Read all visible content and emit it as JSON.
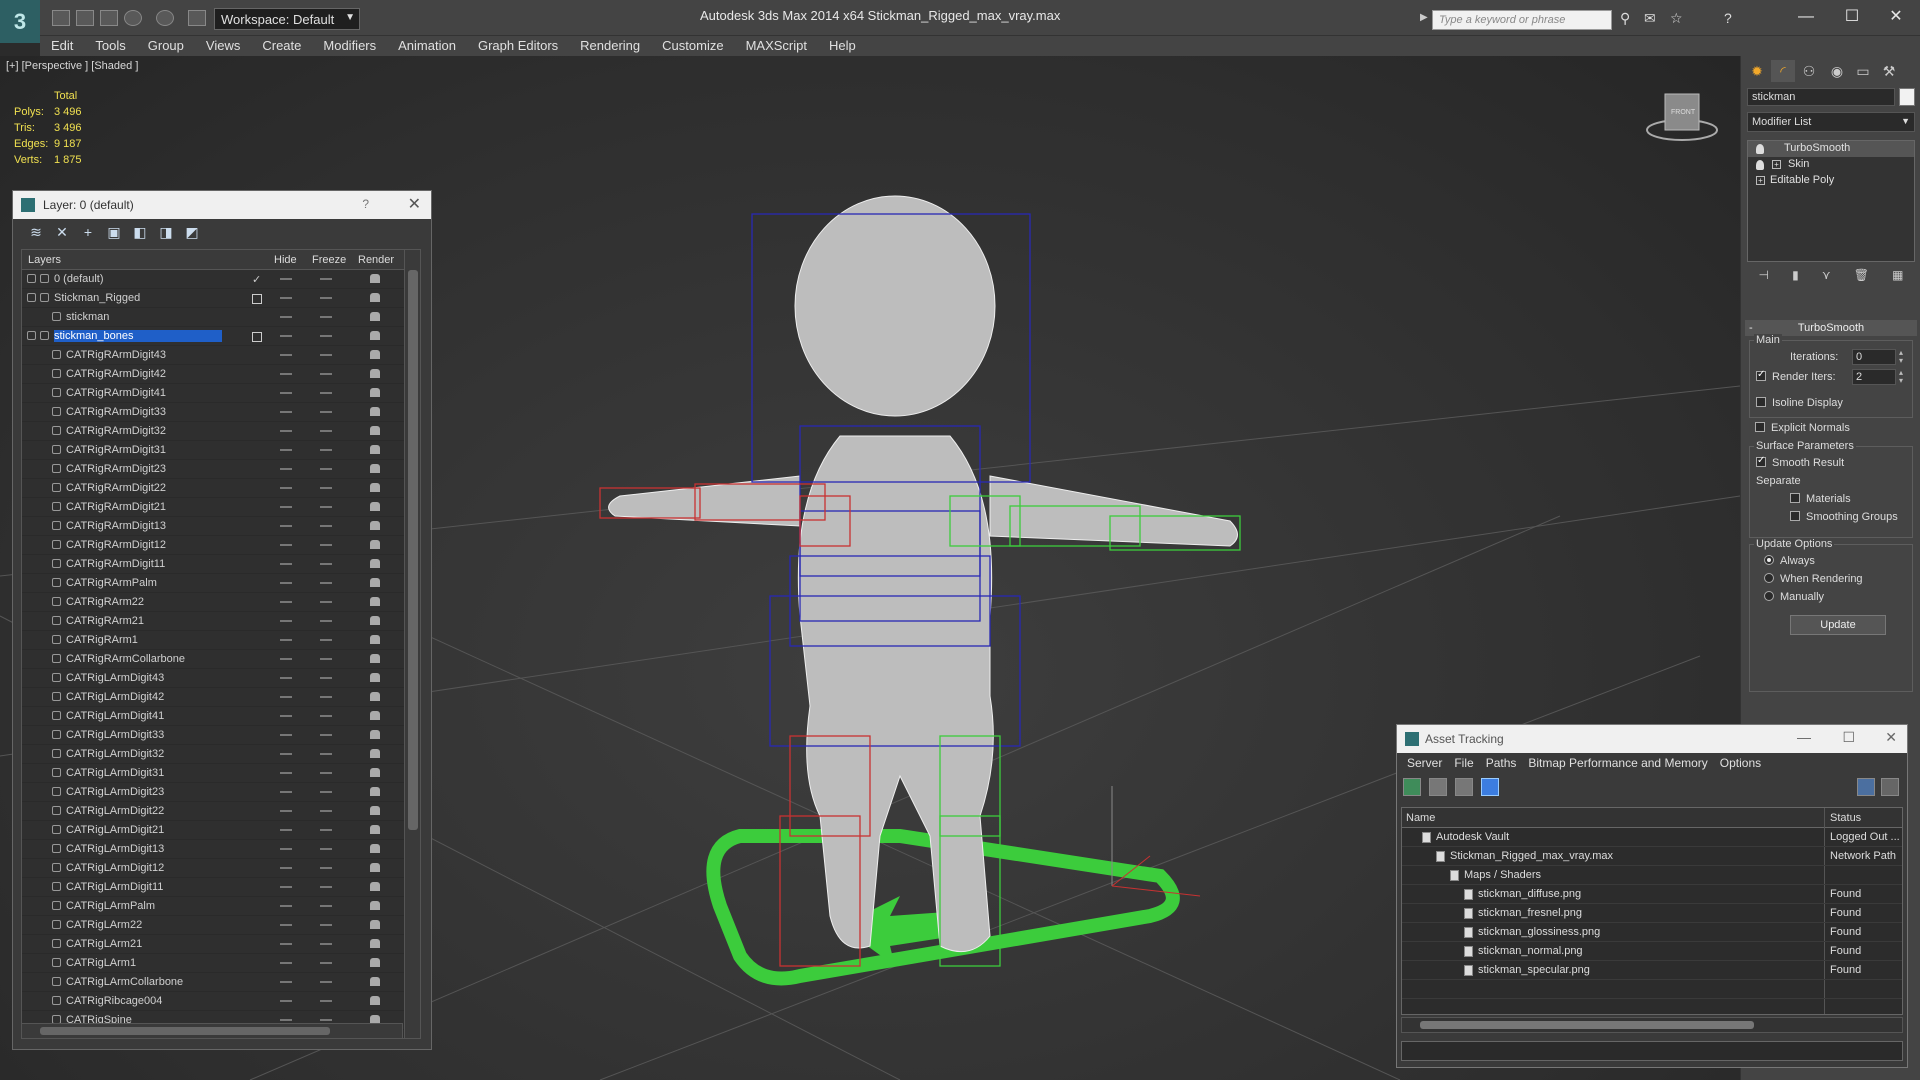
{
  "app": {
    "logo": "3",
    "title": "Autodesk 3ds Max  2014 x64     Stickman_Rigged_max_vray.max",
    "workspace": "Workspace: Default",
    "search_placeholder": "Type a keyword or phrase",
    "minimize": "—",
    "maximize": "☐",
    "close": "✕"
  },
  "menu": [
    "Edit",
    "Tools",
    "Group",
    "Views",
    "Create",
    "Modifiers",
    "Animation",
    "Graph Editors",
    "Rendering",
    "Customize",
    "MAXScript",
    "Help"
  ],
  "viewport": {
    "label": "[+] [Perspective ] [Shaded ]",
    "stats": {
      "header": "Total",
      "rows": [
        {
          "k": "Polys:",
          "v": "3 496"
        },
        {
          "k": "Tris:",
          "v": "3 496"
        },
        {
          "k": "Edges:",
          "v": "9 187"
        },
        {
          "k": "Verts:",
          "v": "1 875"
        }
      ]
    },
    "viewcube_label": "FRONT"
  },
  "layer_dialog": {
    "title": "Layer: 0 (default)",
    "help": "?",
    "close": "✕",
    "columns": {
      "layers": "Layers",
      "hide": "Hide",
      "freeze": "Freeze",
      "render": "Render"
    },
    "rows": [
      {
        "name": "0 (default)",
        "indent": 0,
        "mark": "check"
      },
      {
        "name": "Stickman_Rigged",
        "indent": 0,
        "mark": "box"
      },
      {
        "name": "stickman",
        "indent": 1
      },
      {
        "name": "stickman_bones",
        "indent": 0,
        "mark": "box",
        "selected": true
      },
      {
        "name": "CATRigRArmDigit43",
        "indent": 1
      },
      {
        "name": "CATRigRArmDigit42",
        "indent": 1
      },
      {
        "name": "CATRigRArmDigit41",
        "indent": 1
      },
      {
        "name": "CATRigRArmDigit33",
        "indent": 1
      },
      {
        "name": "CATRigRArmDigit32",
        "indent": 1
      },
      {
        "name": "CATRigRArmDigit31",
        "indent": 1
      },
      {
        "name": "CATRigRArmDigit23",
        "indent": 1
      },
      {
        "name": "CATRigRArmDigit22",
        "indent": 1
      },
      {
        "name": "CATRigRArmDigit21",
        "indent": 1
      },
      {
        "name": "CATRigRArmDigit13",
        "indent": 1
      },
      {
        "name": "CATRigRArmDigit12",
        "indent": 1
      },
      {
        "name": "CATRigRArmDigit11",
        "indent": 1
      },
      {
        "name": "CATRigRArmPalm",
        "indent": 1
      },
      {
        "name": "CATRigRArm22",
        "indent": 1
      },
      {
        "name": "CATRigRArm21",
        "indent": 1
      },
      {
        "name": "CATRigRArm1",
        "indent": 1
      },
      {
        "name": "CATRigRArmCollarbone",
        "indent": 1
      },
      {
        "name": "CATRigLArmDigit43",
        "indent": 1
      },
      {
        "name": "CATRigLArmDigit42",
        "indent": 1
      },
      {
        "name": "CATRigLArmDigit41",
        "indent": 1
      },
      {
        "name": "CATRigLArmDigit33",
        "indent": 1
      },
      {
        "name": "CATRigLArmDigit32",
        "indent": 1
      },
      {
        "name": "CATRigLArmDigit31",
        "indent": 1
      },
      {
        "name": "CATRigLArmDigit23",
        "indent": 1
      },
      {
        "name": "CATRigLArmDigit22",
        "indent": 1
      },
      {
        "name": "CATRigLArmDigit21",
        "indent": 1
      },
      {
        "name": "CATRigLArmDigit13",
        "indent": 1
      },
      {
        "name": "CATRigLArmDigit12",
        "indent": 1
      },
      {
        "name": "CATRigLArmDigit11",
        "indent": 1
      },
      {
        "name": "CATRigLArmPalm",
        "indent": 1
      },
      {
        "name": "CATRigLArm22",
        "indent": 1
      },
      {
        "name": "CATRigLArm21",
        "indent": 1
      },
      {
        "name": "CATRigLArm1",
        "indent": 1
      },
      {
        "name": "CATRigLArmCollarbone",
        "indent": 1
      },
      {
        "name": "CATRigRibcage004",
        "indent": 1
      },
      {
        "name": "CATRigSpine",
        "indent": 1
      }
    ]
  },
  "command_panel": {
    "object_name": "stickman",
    "modifier_list": "Modifier List",
    "stack": [
      {
        "name": "TurboSmooth",
        "icon": "bulb",
        "selected": true
      },
      {
        "name": "Skin",
        "icon": "bulb-plus"
      },
      {
        "name": "Editable Poly",
        "icon": "plus"
      }
    ],
    "rollout_title": "TurboSmooth",
    "rollout_minus": "-",
    "main": {
      "label": "Main",
      "iterations_label": "Iterations:",
      "iterations_value": "0",
      "render_iters_label": "Render Iters:",
      "render_iters_value": "2",
      "render_iters_checked": true,
      "isoline_label": "Isoline Display",
      "explicit_label": "Explicit Normals"
    },
    "surface": {
      "label": "Surface Parameters",
      "smooth_result": "Smooth Result",
      "separate": "Separate",
      "materials": "Materials",
      "smoothing_groups": "Smoothing Groups"
    },
    "update": {
      "label": "Update Options",
      "always": "Always",
      "when_rendering": "When Rendering",
      "manually": "Manually",
      "button": "Update"
    }
  },
  "asset_tracking": {
    "title": "Asset Tracking",
    "menu": [
      "Server",
      "File",
      "Paths",
      "Bitmap Performance and Memory",
      "Options"
    ],
    "columns": {
      "name": "Name",
      "status": "Status"
    },
    "rows": [
      {
        "name": "Autodesk Vault",
        "indent": 1,
        "status": "Logged Out ..."
      },
      {
        "name": "Stickman_Rigged_max_vray.max",
        "indent": 2,
        "status": "Network Path"
      },
      {
        "name": "Maps / Shaders",
        "indent": 3,
        "status": ""
      },
      {
        "name": "stickman_diffuse.png",
        "indent": 4,
        "status": "Found"
      },
      {
        "name": "stickman_fresnel.png",
        "indent": 4,
        "status": "Found"
      },
      {
        "name": "stickman_glossiness.png",
        "indent": 4,
        "status": "Found"
      },
      {
        "name": "stickman_normal.png",
        "indent": 4,
        "status": "Found"
      },
      {
        "name": "stickman_specular.png",
        "indent": 4,
        "status": "Found"
      }
    ]
  },
  "colors": {
    "accent": "#f2a82a",
    "selection": "#1f5fc8",
    "stats_text": "#f0e050",
    "bones_left": "#3ccc3c",
    "bones_right": "#c83232",
    "bones_spine": "#2828b4"
  }
}
